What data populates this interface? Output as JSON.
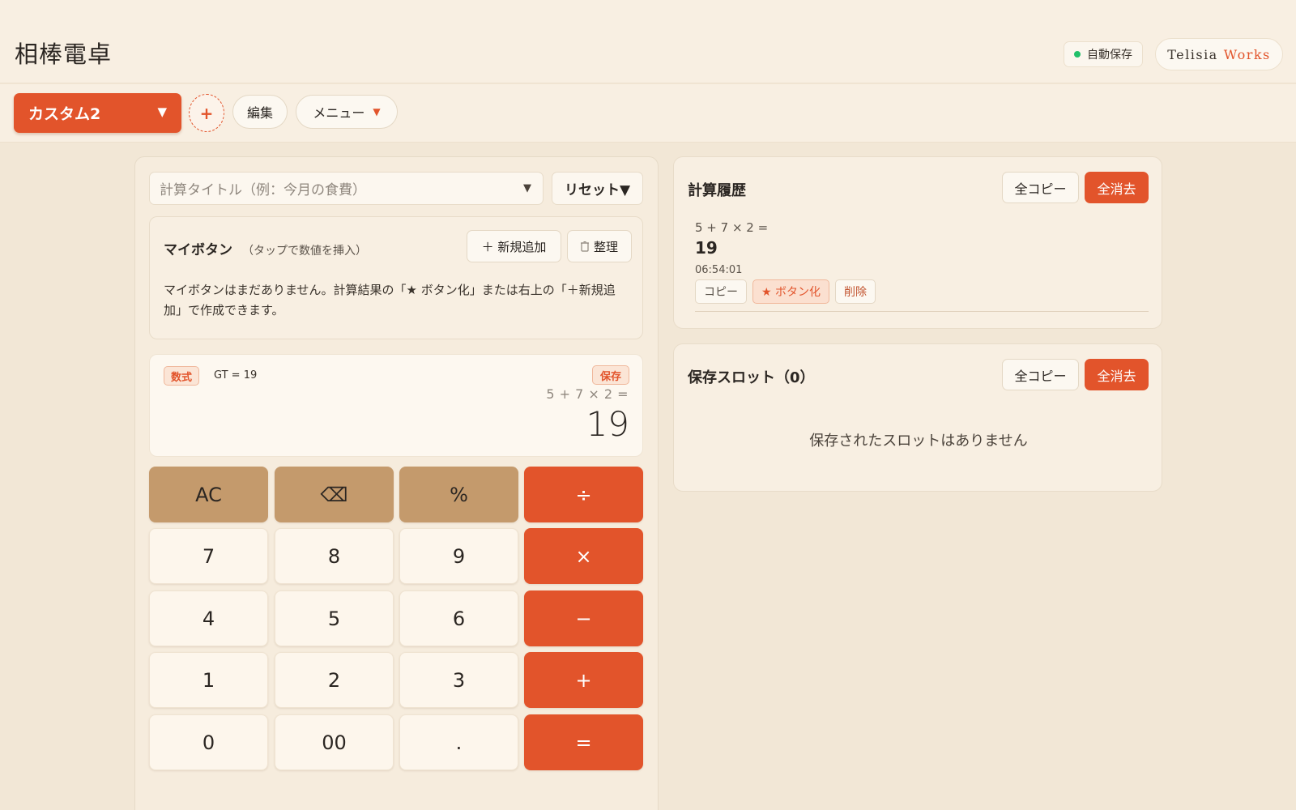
{
  "header": {
    "app_title": "相棒電卓",
    "autosave_label": "自動保存",
    "brand_main": "Telisia",
    "brand_accent": "Works"
  },
  "toolbar": {
    "preset_label": "カスタム2",
    "add_label": "+",
    "edit_label": "編集",
    "menu_label": "メニュー"
  },
  "calculator": {
    "title_placeholder": "計算タイトル（例：今月の食費）",
    "reset_label": "リセット▼",
    "my_buttons": {
      "title": "マイボタン",
      "hint": "（タップで数値を挿入）",
      "new_label": "＋ 新規追加",
      "sort_label": "整理",
      "empty_text": "マイボタンはまだありません。計算結果の「★ ボタン化」または右上の「＋新規追加」で作成できます。"
    },
    "display": {
      "mode_badge": "数式",
      "grand_total": "GT = 19",
      "save_badge": "保存",
      "expression": "5 + 7 × 2 =",
      "result": "19"
    },
    "keys": [
      [
        "AC",
        "⌫",
        "%",
        "÷"
      ],
      [
        "7",
        "8",
        "9",
        "×"
      ],
      [
        "4",
        "5",
        "6",
        "−"
      ],
      [
        "1",
        "2",
        "3",
        "+"
      ],
      [
        "0",
        "00",
        ".",
        "="
      ]
    ]
  },
  "history": {
    "title": "計算履歴",
    "copy_all_label": "全コピー",
    "clear_all_label": "全消去",
    "items": [
      {
        "expression": "5 + 7 × 2 =",
        "result": "19",
        "time": "06:54:01",
        "copy_label": "コピー",
        "to_button_label": "★ ボタン化",
        "delete_label": "削除"
      }
    ]
  },
  "slots": {
    "title": "保存スロット（0）",
    "copy_all_label": "全コピー",
    "clear_all_label": "全消去",
    "empty_text": "保存されたスロットはありません"
  },
  "colors": {
    "accent": "#e2542b",
    "background": "#f2e7d6",
    "function_key": "#c49a6c",
    "autosave_dot": "#22c06a"
  }
}
